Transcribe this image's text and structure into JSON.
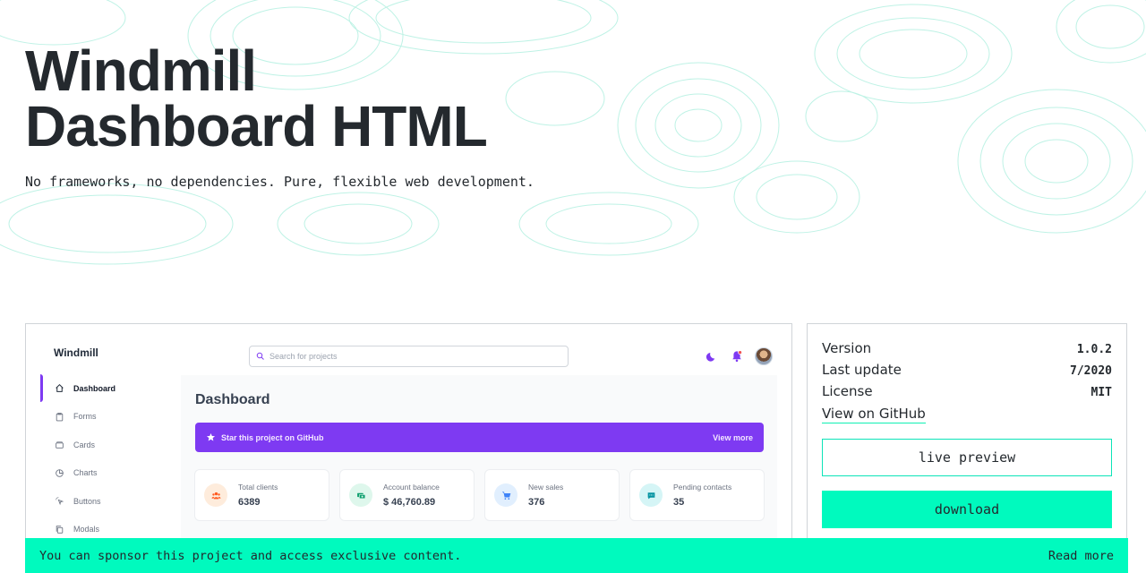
{
  "hero": {
    "title_line1": "Windmill",
    "title_line2": "Dashboard HTML",
    "subtitle": "No frameworks, no dependencies. Pure, flexible web development."
  },
  "preview": {
    "brand": "Windmill",
    "search_placeholder": "Search for projects",
    "nav": [
      {
        "label": "Dashboard",
        "icon": "home-icon",
        "active": true
      },
      {
        "label": "Forms",
        "icon": "clipboard-icon"
      },
      {
        "label": "Cards",
        "icon": "cards-icon"
      },
      {
        "label": "Charts",
        "icon": "pie-chart-icon"
      },
      {
        "label": "Buttons",
        "icon": "cursor-click-icon"
      },
      {
        "label": "Modals",
        "icon": "duplicate-icon"
      }
    ],
    "heading": "Dashboard",
    "banner": {
      "text": "Star this project on GitHub",
      "link": "View more"
    },
    "stats": [
      {
        "label": "Total clients",
        "value": "6389",
        "icon": "users-icon",
        "color": "#ff5a1f",
        "bg": "#feecdc"
      },
      {
        "label": "Account balance",
        "value": "$ 46,760.89",
        "icon": "cash-icon",
        "color": "#0e9f6e",
        "bg": "#def7ec"
      },
      {
        "label": "New sales",
        "value": "376",
        "icon": "cart-icon",
        "color": "#3f83f8",
        "bg": "#e1effe"
      },
      {
        "label": "Pending contacts",
        "value": "35",
        "icon": "chat-icon",
        "color": "#0694a2",
        "bg": "#d5f5f6"
      }
    ],
    "accent": "#7e3af2"
  },
  "info": {
    "version_label": "Version",
    "version": "1.0.2",
    "updated_label": "Last update",
    "updated": "7/2020",
    "license_label": "License",
    "license": "MIT",
    "github_link": "View on GitHub",
    "live_preview": "live preview",
    "download": "download"
  },
  "sponsor": {
    "text": "You can sponsor this project and access exclusive content.",
    "link": "Read more"
  },
  "colors": {
    "mint": "#00fabe",
    "text": "#24292e"
  }
}
